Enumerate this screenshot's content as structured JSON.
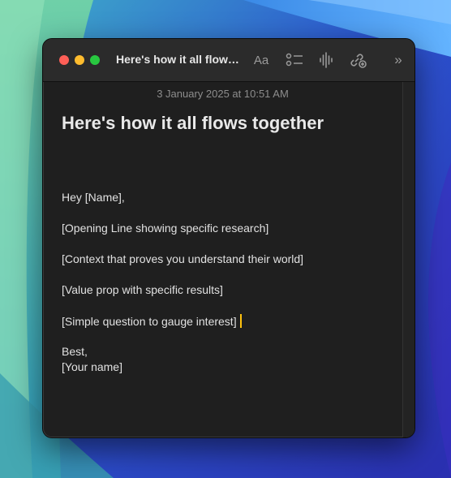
{
  "window": {
    "title": "Here's how it all flows together"
  },
  "toolbar": {
    "format_label": "Aa",
    "icons": [
      "format-icon",
      "checklist-icon",
      "audio-icon",
      "collaborate-icon",
      "more-icon"
    ]
  },
  "note": {
    "date": "3 January 2025 at 10:51 AM",
    "heading": "Here's how it all flows together",
    "lines": [
      "Hey [Name],",
      "[Opening Line showing specific research]",
      "[Context that proves you understand their world]",
      "[Value prop with specific results]",
      "[Simple question to gauge interest]",
      "Best,",
      "[Your name]"
    ]
  },
  "colors": {
    "close": "#fe5f57",
    "minimize": "#febc2e",
    "maximize": "#28c840",
    "caret": "#ffc20e",
    "window_bg": "#1f1f1f"
  }
}
